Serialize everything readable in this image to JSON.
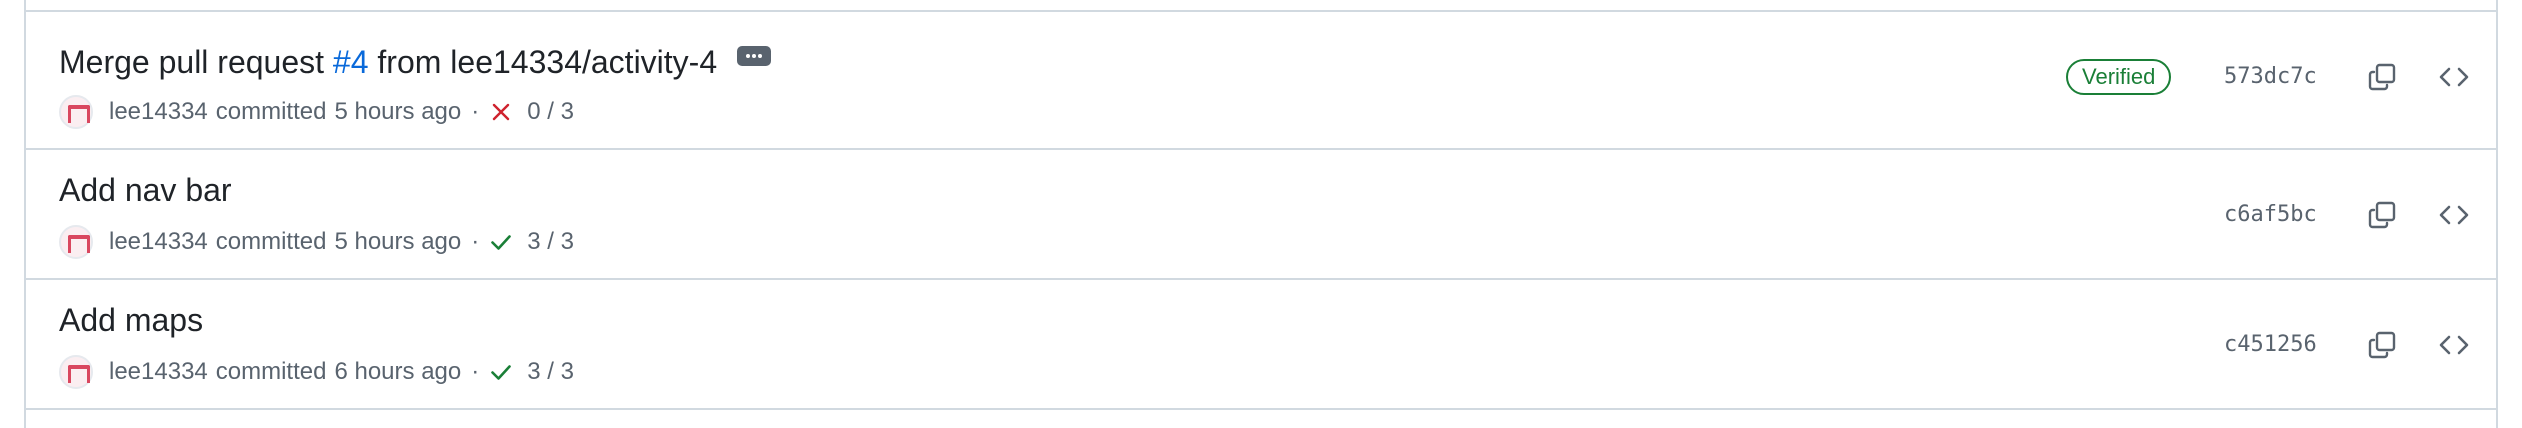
{
  "colors": {
    "border": "#d1d9e0",
    "link": "#0969da",
    "muted": "#59636e",
    "success": "#1a7f37",
    "danger": "#cf222e"
  },
  "commits": [
    {
      "title_prefix": "Merge pull request ",
      "pr_link": "#4",
      "title_suffix": " from lee14334/activity-4",
      "has_ellipsis": true,
      "author": "lee14334",
      "action": "committed",
      "time": "5 hours ago",
      "separator": "·",
      "status": "failure",
      "status_icon": "x-icon",
      "checks": "0 / 3",
      "verified": "Verified",
      "sha": "573dc7c"
    },
    {
      "title": "Add nav bar",
      "author": "lee14334",
      "action": "committed",
      "time": "5 hours ago",
      "separator": "·",
      "status": "success",
      "status_icon": "check-icon",
      "checks": "3 / 3",
      "sha": "c6af5bc"
    },
    {
      "title": "Add maps",
      "author": "lee14334",
      "action": "committed",
      "time": "6 hours ago",
      "separator": "·",
      "status": "success",
      "status_icon": "check-icon",
      "checks": "3 / 3",
      "sha": "c451256"
    }
  ]
}
